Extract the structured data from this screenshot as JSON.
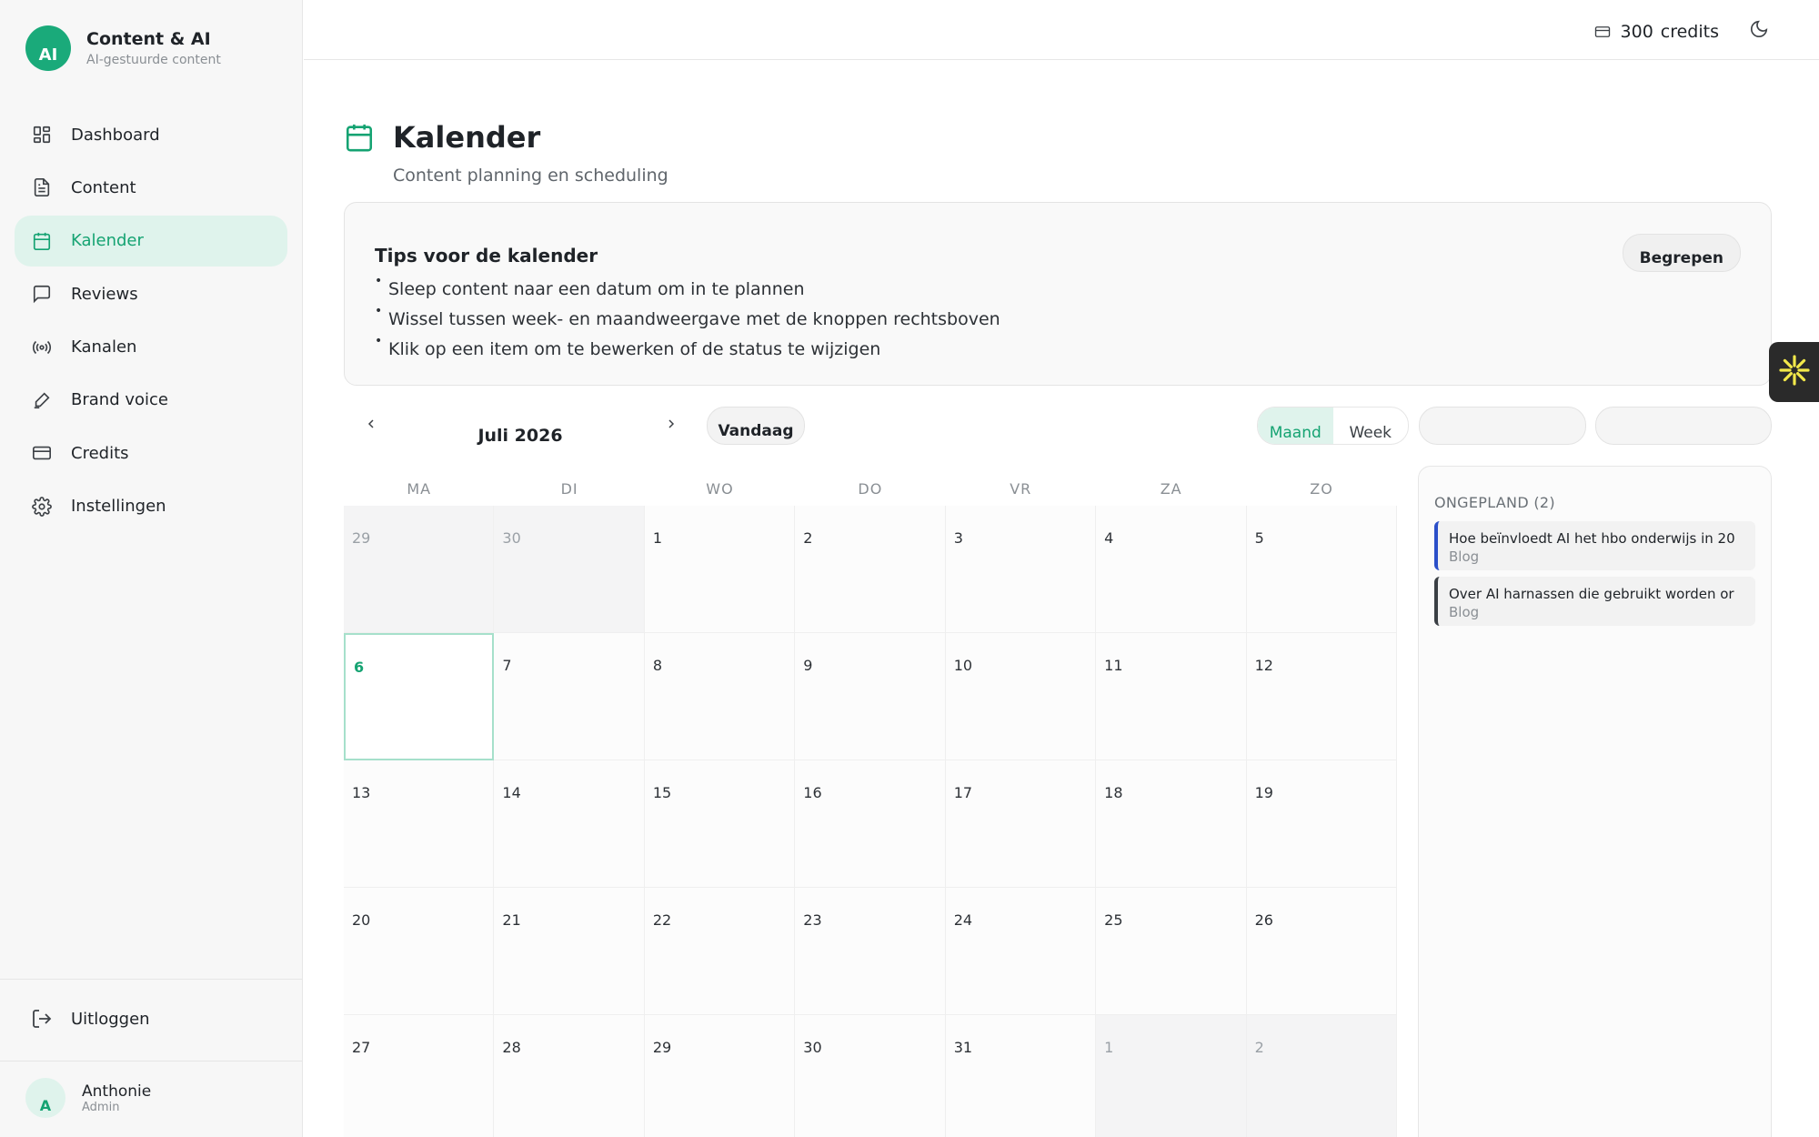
{
  "sidebar": {
    "brand": {
      "logo_text": "AI",
      "title": "Content & AI",
      "subtitle": "AI-gestuurde content"
    },
    "items": [
      {
        "label": "Dashboard",
        "icon": "dashboard-icon"
      },
      {
        "label": "Content",
        "icon": "document-icon"
      },
      {
        "label": "Kalender",
        "icon": "calendar-icon",
        "active": true
      },
      {
        "label": "Reviews",
        "icon": "message-icon"
      },
      {
        "label": "Kanalen",
        "icon": "broadcast-icon"
      },
      {
        "label": "Brand voice",
        "icon": "pen-icon"
      },
      {
        "label": "Credits",
        "icon": "credit-card-icon"
      },
      {
        "label": "Instellingen",
        "icon": "gear-icon"
      }
    ],
    "logout_label": "Uitloggen",
    "user": {
      "initial": "A",
      "name": "Anthonie",
      "role": "Admin"
    }
  },
  "topbar": {
    "credits_amount": "300",
    "credits_label": "credits",
    "theme_icon": "moon-icon"
  },
  "header": {
    "title": "Kalender",
    "subtitle": "Content planning en scheduling"
  },
  "tips": {
    "title": "Tips voor de kalender",
    "items": [
      "Sleep content naar een datum om in te plannen",
      "Wissel tussen week- en maandweergave met de knoppen rechtsboven",
      "Klik op een item om te bewerken of de status te wijzigen"
    ],
    "dismiss_label": "Begrepen"
  },
  "calendar": {
    "month_label": "Juli 2026",
    "today_label": "Vandaag",
    "views": [
      "Maand",
      "Week"
    ],
    "active_view": "Maand",
    "filters": [
      "",
      ""
    ],
    "weekdays": [
      "MA",
      "DI",
      "WO",
      "DO",
      "VR",
      "ZA",
      "ZO"
    ],
    "days": [
      "29",
      "30",
      "1",
      "2",
      "3",
      "4",
      "5",
      "6",
      "7",
      "8",
      "9",
      "10",
      "11",
      "12",
      "13",
      "14",
      "15",
      "16",
      "17",
      "18",
      "19",
      "20",
      "21",
      "22",
      "23",
      "24",
      "25",
      "26",
      "27",
      "28",
      "29",
      "30",
      "31",
      "1",
      "2"
    ],
    "outside_month_indices": [
      0,
      1,
      33,
      34
    ],
    "today_index": 7
  },
  "unplanned": {
    "title": "ONGEPLAND (2)",
    "items": [
      {
        "title": "Hoe beïnvloedt AI het hbo onderwijs in 20",
        "type": "Blog",
        "accent": "#2b4fc9"
      },
      {
        "title": "Over AI harnassen die gebruikt worden or",
        "type": "Blog",
        "accent": "#3a3f44"
      }
    ]
  },
  "colors": {
    "accent": "#15a372",
    "accent_soft": "#dff3ec",
    "float_button": "#2a2a2a",
    "float_icon": "#f2e84a"
  }
}
